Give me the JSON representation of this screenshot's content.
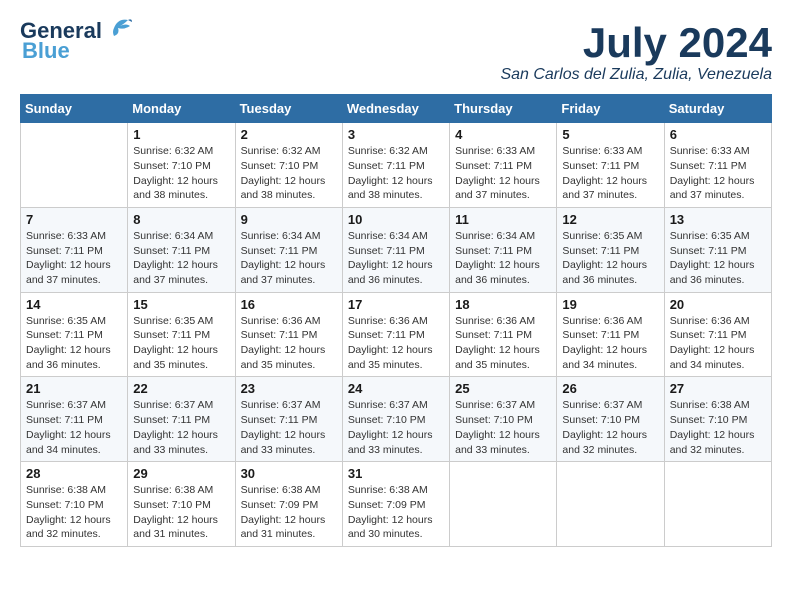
{
  "header": {
    "logo_line1": "General",
    "logo_line2": "Blue",
    "month_title": "July 2024",
    "location": "San Carlos del Zulia, Zulia, Venezuela"
  },
  "days_of_week": [
    "Sunday",
    "Monday",
    "Tuesday",
    "Wednesday",
    "Thursday",
    "Friday",
    "Saturday"
  ],
  "weeks": [
    [
      {
        "day": "",
        "sunrise": "",
        "sunset": "",
        "daylight": ""
      },
      {
        "day": "1",
        "sunrise": "Sunrise: 6:32 AM",
        "sunset": "Sunset: 7:10 PM",
        "daylight": "Daylight: 12 hours and 38 minutes."
      },
      {
        "day": "2",
        "sunrise": "Sunrise: 6:32 AM",
        "sunset": "Sunset: 7:10 PM",
        "daylight": "Daylight: 12 hours and 38 minutes."
      },
      {
        "day": "3",
        "sunrise": "Sunrise: 6:32 AM",
        "sunset": "Sunset: 7:11 PM",
        "daylight": "Daylight: 12 hours and 38 minutes."
      },
      {
        "day": "4",
        "sunrise": "Sunrise: 6:33 AM",
        "sunset": "Sunset: 7:11 PM",
        "daylight": "Daylight: 12 hours and 37 minutes."
      },
      {
        "day": "5",
        "sunrise": "Sunrise: 6:33 AM",
        "sunset": "Sunset: 7:11 PM",
        "daylight": "Daylight: 12 hours and 37 minutes."
      },
      {
        "day": "6",
        "sunrise": "Sunrise: 6:33 AM",
        "sunset": "Sunset: 7:11 PM",
        "daylight": "Daylight: 12 hours and 37 minutes."
      }
    ],
    [
      {
        "day": "7",
        "sunrise": "Sunrise: 6:33 AM",
        "sunset": "Sunset: 7:11 PM",
        "daylight": "Daylight: 12 hours and 37 minutes."
      },
      {
        "day": "8",
        "sunrise": "Sunrise: 6:34 AM",
        "sunset": "Sunset: 7:11 PM",
        "daylight": "Daylight: 12 hours and 37 minutes."
      },
      {
        "day": "9",
        "sunrise": "Sunrise: 6:34 AM",
        "sunset": "Sunset: 7:11 PM",
        "daylight": "Daylight: 12 hours and 37 minutes."
      },
      {
        "day": "10",
        "sunrise": "Sunrise: 6:34 AM",
        "sunset": "Sunset: 7:11 PM",
        "daylight": "Daylight: 12 hours and 36 minutes."
      },
      {
        "day": "11",
        "sunrise": "Sunrise: 6:34 AM",
        "sunset": "Sunset: 7:11 PM",
        "daylight": "Daylight: 12 hours and 36 minutes."
      },
      {
        "day": "12",
        "sunrise": "Sunrise: 6:35 AM",
        "sunset": "Sunset: 7:11 PM",
        "daylight": "Daylight: 12 hours and 36 minutes."
      },
      {
        "day": "13",
        "sunrise": "Sunrise: 6:35 AM",
        "sunset": "Sunset: 7:11 PM",
        "daylight": "Daylight: 12 hours and 36 minutes."
      }
    ],
    [
      {
        "day": "14",
        "sunrise": "Sunrise: 6:35 AM",
        "sunset": "Sunset: 7:11 PM",
        "daylight": "Daylight: 12 hours and 36 minutes."
      },
      {
        "day": "15",
        "sunrise": "Sunrise: 6:35 AM",
        "sunset": "Sunset: 7:11 PM",
        "daylight": "Daylight: 12 hours and 35 minutes."
      },
      {
        "day": "16",
        "sunrise": "Sunrise: 6:36 AM",
        "sunset": "Sunset: 7:11 PM",
        "daylight": "Daylight: 12 hours and 35 minutes."
      },
      {
        "day": "17",
        "sunrise": "Sunrise: 6:36 AM",
        "sunset": "Sunset: 7:11 PM",
        "daylight": "Daylight: 12 hours and 35 minutes."
      },
      {
        "day": "18",
        "sunrise": "Sunrise: 6:36 AM",
        "sunset": "Sunset: 7:11 PM",
        "daylight": "Daylight: 12 hours and 35 minutes."
      },
      {
        "day": "19",
        "sunrise": "Sunrise: 6:36 AM",
        "sunset": "Sunset: 7:11 PM",
        "daylight": "Daylight: 12 hours and 34 minutes."
      },
      {
        "day": "20",
        "sunrise": "Sunrise: 6:36 AM",
        "sunset": "Sunset: 7:11 PM",
        "daylight": "Daylight: 12 hours and 34 minutes."
      }
    ],
    [
      {
        "day": "21",
        "sunrise": "Sunrise: 6:37 AM",
        "sunset": "Sunset: 7:11 PM",
        "daylight": "Daylight: 12 hours and 34 minutes."
      },
      {
        "day": "22",
        "sunrise": "Sunrise: 6:37 AM",
        "sunset": "Sunset: 7:11 PM",
        "daylight": "Daylight: 12 hours and 33 minutes."
      },
      {
        "day": "23",
        "sunrise": "Sunrise: 6:37 AM",
        "sunset": "Sunset: 7:11 PM",
        "daylight": "Daylight: 12 hours and 33 minutes."
      },
      {
        "day": "24",
        "sunrise": "Sunrise: 6:37 AM",
        "sunset": "Sunset: 7:10 PM",
        "daylight": "Daylight: 12 hours and 33 minutes."
      },
      {
        "day": "25",
        "sunrise": "Sunrise: 6:37 AM",
        "sunset": "Sunset: 7:10 PM",
        "daylight": "Daylight: 12 hours and 33 minutes."
      },
      {
        "day": "26",
        "sunrise": "Sunrise: 6:37 AM",
        "sunset": "Sunset: 7:10 PM",
        "daylight": "Daylight: 12 hours and 32 minutes."
      },
      {
        "day": "27",
        "sunrise": "Sunrise: 6:38 AM",
        "sunset": "Sunset: 7:10 PM",
        "daylight": "Daylight: 12 hours and 32 minutes."
      }
    ],
    [
      {
        "day": "28",
        "sunrise": "Sunrise: 6:38 AM",
        "sunset": "Sunset: 7:10 PM",
        "daylight": "Daylight: 12 hours and 32 minutes."
      },
      {
        "day": "29",
        "sunrise": "Sunrise: 6:38 AM",
        "sunset": "Sunset: 7:10 PM",
        "daylight": "Daylight: 12 hours and 31 minutes."
      },
      {
        "day": "30",
        "sunrise": "Sunrise: 6:38 AM",
        "sunset": "Sunset: 7:09 PM",
        "daylight": "Daylight: 12 hours and 31 minutes."
      },
      {
        "day": "31",
        "sunrise": "Sunrise: 6:38 AM",
        "sunset": "Sunset: 7:09 PM",
        "daylight": "Daylight: 12 hours and 30 minutes."
      },
      {
        "day": "",
        "sunrise": "",
        "sunset": "",
        "daylight": ""
      },
      {
        "day": "",
        "sunrise": "",
        "sunset": "",
        "daylight": ""
      },
      {
        "day": "",
        "sunrise": "",
        "sunset": "",
        "daylight": ""
      }
    ]
  ]
}
